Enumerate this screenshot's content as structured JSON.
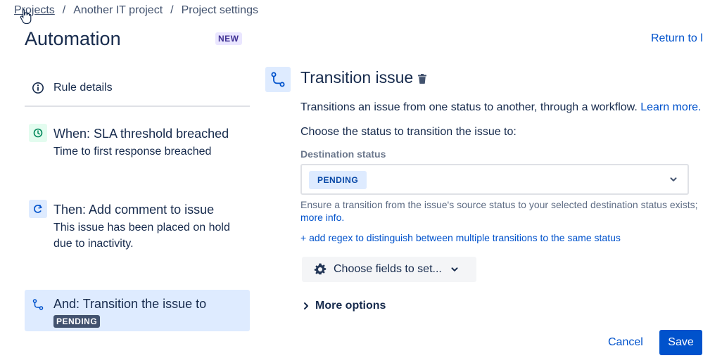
{
  "breadcrumb": {
    "items": [
      "Projects",
      "Another IT project",
      "Project settings"
    ],
    "separator": "/"
  },
  "header": {
    "title": "Automation",
    "badge": "NEW",
    "return_link": "Return to l"
  },
  "sidebar": {
    "rule_details": "Rule details",
    "steps": [
      {
        "title": "When: SLA threshold breached",
        "subtitle": "Time to first response breached",
        "icon": "clock-icon"
      },
      {
        "title": "Then: Add comment to issue",
        "subtitle": "This issue has been placed on hold due to inactivity.",
        "icon": "comment-icon"
      },
      {
        "title": "And: Transition the issue to",
        "badge": "PENDING",
        "icon": "transition-icon"
      }
    ]
  },
  "panel": {
    "title": "Transition issue",
    "description": "Transitions an issue from one status to another, through a workflow. ",
    "learn_more": "Learn more.",
    "choose_label": "Choose the status to transition the issue to:",
    "destination_label": "Destination status",
    "destination_value": "PENDING",
    "hint": "Ensure a transition from the issue's source status to your selected destination status exists;",
    "hint_link": "more info.",
    "regex_link": "+ add regex to distinguish between multiple transitions to the same status",
    "choose_fields": "Choose fields to set...",
    "more_options": "More options"
  },
  "actions": {
    "cancel": "Cancel",
    "save": "Save"
  },
  "colors": {
    "accent": "#0052cc",
    "selected_bg": "#deebff",
    "green_bg": "#e3fcef"
  }
}
